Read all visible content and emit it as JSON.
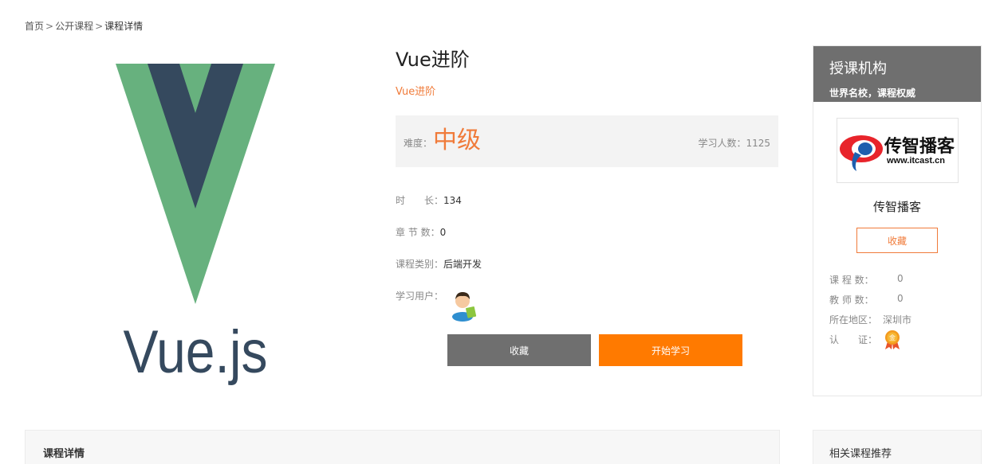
{
  "breadcrumb": {
    "home": "首页",
    "separator": ">",
    "public_courses": "公开课程",
    "current": "课程详情"
  },
  "course": {
    "image_text": "Vue.js",
    "title": "Vue进阶",
    "subtitle": "Vue进阶",
    "difficulty_label": "难度：",
    "difficulty": "中级",
    "students_label": "学习人数：",
    "students": "1125",
    "duration_label": "时　　长：",
    "duration": "134",
    "chapters_label": "章 节 数：",
    "chapters": "0",
    "category_label": "课程类别：",
    "category": "后端开发",
    "learners_label": "学习用户："
  },
  "actions": {
    "favorite": "收藏",
    "start": "开始学习"
  },
  "organization": {
    "section_title": "授课机构",
    "tagline": "世界名校，课程权威",
    "logo_text": "传智播客",
    "logo_url_text": "www.itcast.cn",
    "name": "传智播客",
    "favorite": "收藏",
    "courses_label": "课 程 数：",
    "courses": "0",
    "teachers_label": "教 师 数：",
    "teachers": "0",
    "location_label": "所在地区：",
    "location": "深圳市",
    "cert_label": "认　　证：",
    "cert_badge_text": "金"
  },
  "tabs": {
    "detail": "课程详情",
    "related": "相关课程推荐"
  },
  "colors": {
    "accent": "#f07b3a",
    "primary_button": "#ff7a00",
    "secondary_button": "#6f6f6f",
    "vue_green": "#67b17e",
    "vue_dark": "#35495e"
  }
}
